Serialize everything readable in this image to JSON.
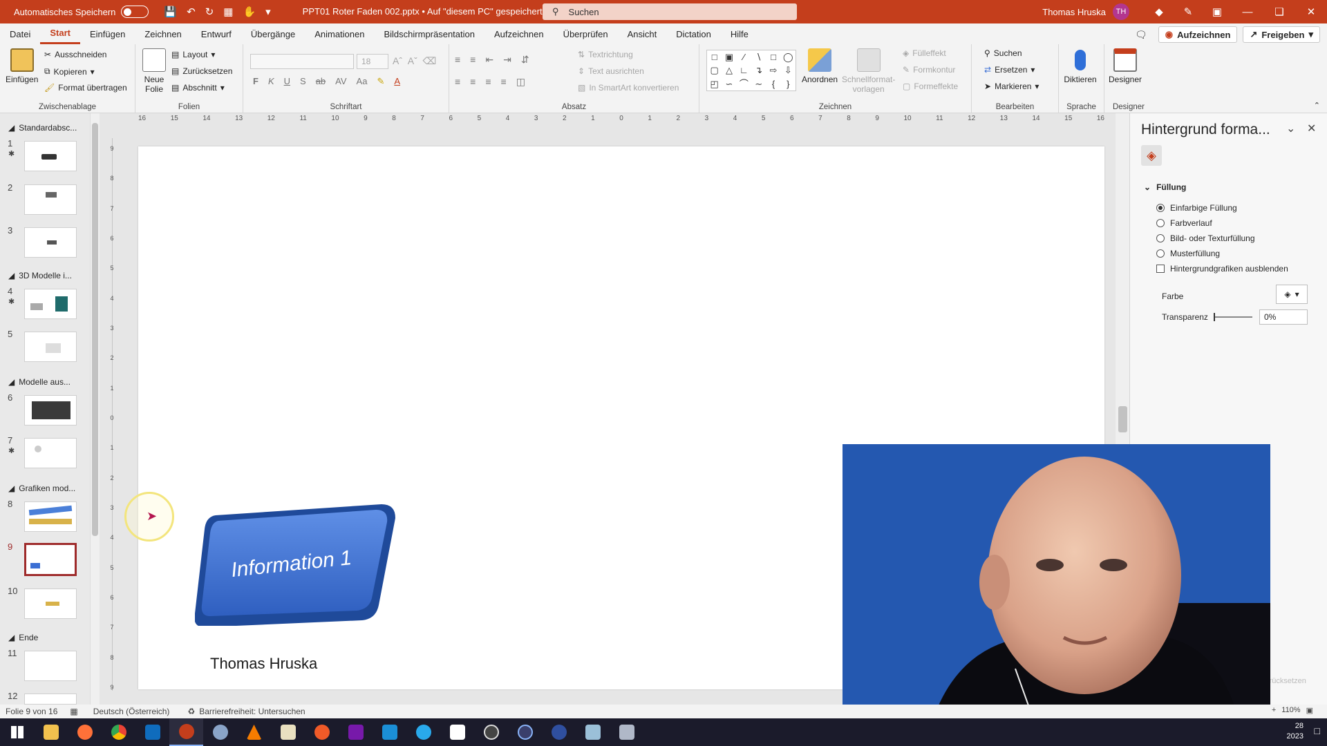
{
  "titlebar": {
    "autosave_label": "Automatisches Speichern",
    "document_title": "PPT01 Roter Faden 002.pptx • Auf \"diesem PC\" gespeichert",
    "search_placeholder": "Suchen",
    "user_name": "Thomas Hruska",
    "user_initials": "TH"
  },
  "menu": {
    "items": [
      "Datei",
      "Start",
      "Einfügen",
      "Zeichnen",
      "Entwurf",
      "Übergänge",
      "Animationen",
      "Bildschirmpräsentation",
      "Aufzeichnen",
      "Überprüfen",
      "Ansicht",
      "Dictation",
      "Hilfe"
    ],
    "active": "Start",
    "record_label": "Aufzeichnen",
    "share_label": "Freigeben"
  },
  "ribbon": {
    "clipboard": {
      "paste": "Einfügen",
      "cut": "Ausschneiden",
      "copy": "Kopieren",
      "format_painter": "Format übertragen",
      "label": "Zwischenablage"
    },
    "slides": {
      "new_slide_1": "Neue",
      "new_slide_2": "Folie",
      "layout": "Layout",
      "reset": "Zurücksetzen",
      "section": "Abschnitt",
      "label": "Folien"
    },
    "font": {
      "size": "18",
      "label": "Schriftart",
      "bold": "F",
      "italic": "K",
      "underline": "U",
      "shadow": "S",
      "strike": "ab",
      "spacing": "AV",
      "case": "Aa"
    },
    "paragraph": {
      "text_direction": "Textrichtung",
      "align_text": "Text ausrichten",
      "smartart": "In SmartArt konvertieren",
      "label": "Absatz"
    },
    "drawing": {
      "arrange": "Anordnen",
      "quick_styles_1": "Schnellformat-",
      "quick_styles_2": "vorlagen",
      "fill": "Fülleffekt",
      "contour": "Formkontur",
      "effects": "Formeffekte",
      "label": "Zeichnen"
    },
    "editing": {
      "find": "Suchen",
      "replace": "Ersetzen",
      "select": "Markieren",
      "label": "Bearbeiten"
    },
    "voice": {
      "dictate": "Diktieren",
      "label": "Sprache"
    },
    "designer": {
      "button": "Designer",
      "label": "Designer"
    }
  },
  "slide_panel": {
    "sections": [
      "Standardabsc...",
      "3D Modelle i...",
      "Modelle aus...",
      "Grafiken mod...",
      "Ende"
    ],
    "numbers": [
      "1",
      "2",
      "3",
      "4",
      "5",
      "6",
      "7",
      "8",
      "9",
      "10",
      "11",
      "12"
    ],
    "selected": "9"
  },
  "slide": {
    "info_text": "Information 1",
    "author": "Thomas Hruska"
  },
  "format_pane": {
    "title": "Hintergrund forma...",
    "section": "Füllung",
    "options": [
      "Einfarbige Füllung",
      "Farbverlauf",
      "Bild- oder Texturfüllung",
      "Musterfüllung"
    ],
    "selected_option": "Einfarbige Füllung",
    "hide_graphics": "Hintergrundgrafiken ausblenden",
    "color_label": "Farbe",
    "transparency_label": "Transparenz",
    "transparency_value": "0%",
    "transparency": 0,
    "reset_label": "zurücksetzen"
  },
  "statusbar": {
    "slide_info": "Folie 9 von 16",
    "language": "Deutsch (Österreich)",
    "accessibility": "Barrierefreiheit: Untersuchen",
    "zoom": "110%"
  },
  "taskbar": {
    "clock_line1": "28",
    "clock_line2": "2023"
  },
  "colors": {
    "accent": "#c43e1c",
    "shape_blue": "#3b6fd4",
    "selection": "#9e2a2a"
  }
}
